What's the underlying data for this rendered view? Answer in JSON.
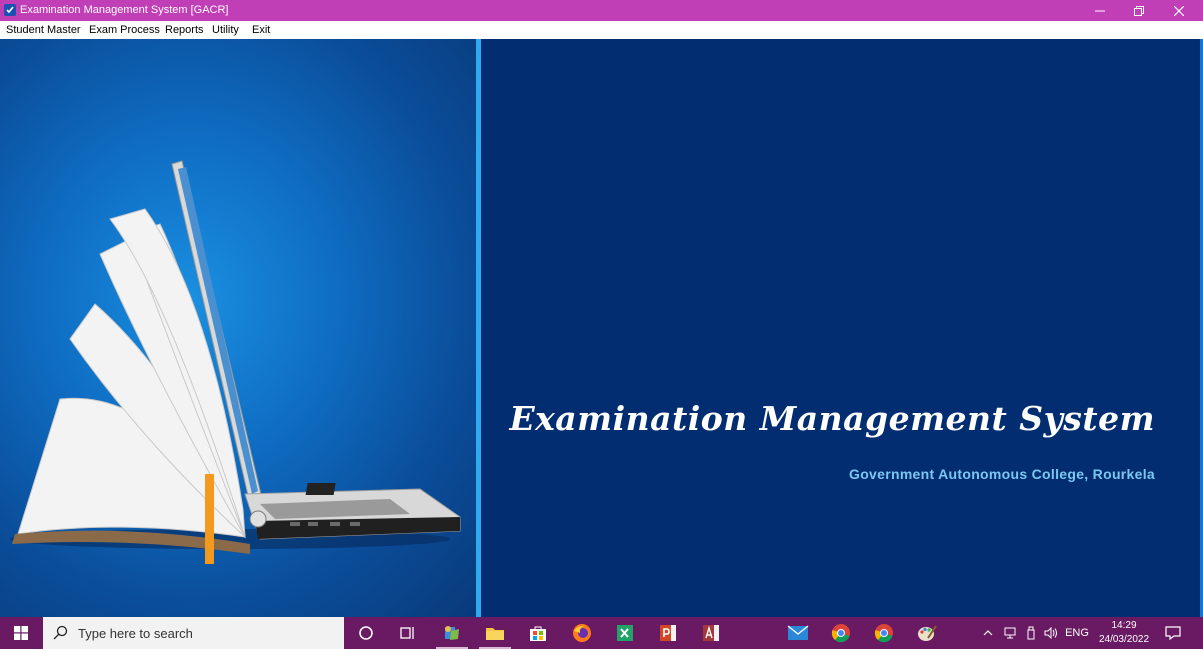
{
  "window": {
    "title": "Examination Management System  [GACR]",
    "controls": {
      "minimize": "–",
      "restore": "❐",
      "close": "✕"
    }
  },
  "menu": {
    "items": [
      "Student Master",
      "Exam Process",
      "Reports",
      "Utility",
      "Exit"
    ]
  },
  "splash": {
    "title": "Examination Management System",
    "subtitle": "Government Autonomous College, Rourkela",
    "illustration": "laptop-book-icon"
  },
  "taskbar": {
    "search_placeholder": "Type here to search",
    "apps": [
      "cortana-icon",
      "task-view-icon",
      "app-icon",
      "file-explorer-icon",
      "store-icon",
      "firefox-icon",
      "excel-icon",
      "powerpoint-icon",
      "access-icon",
      "mail-icon",
      "chrome-icon",
      "chrome-icon",
      "paint-icon"
    ],
    "tray": {
      "language": "ENG",
      "time": "14:29",
      "date": "24/03/2022"
    }
  },
  "colors": {
    "titlebar": "#c13fb6",
    "taskbar": "#6a1a63",
    "right_panel": "#022d70",
    "divider": "#2fa9f0",
    "subtitle": "#7cc7f2"
  }
}
